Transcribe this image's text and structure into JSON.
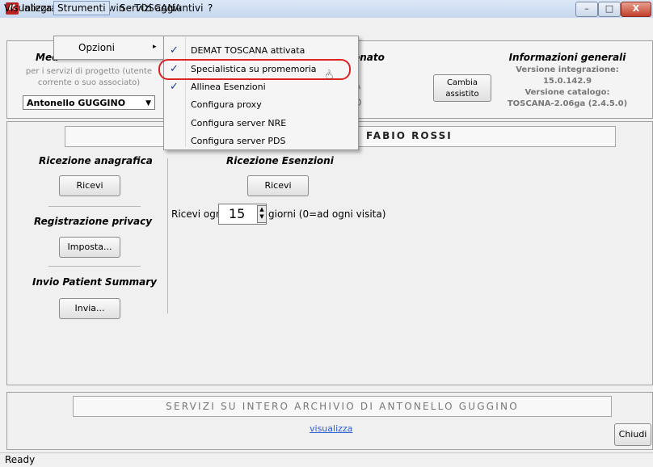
{
  "window": {
    "title": "Integrazione Millewin - TOSCANA",
    "min_glyph": "–",
    "max_glyph": "□",
    "close_glyph": "X"
  },
  "menubar": {
    "visualizza": "Visualizza",
    "strumenti": "Strumenti",
    "servizi": "Servizi aggiuntivi",
    "help": "?"
  },
  "strumenti_menu": {
    "opzioni": "Opzioni",
    "opzioni_arrow": "▸"
  },
  "opzioni_submenu": {
    "items": [
      {
        "label": "DEMAT TOSCANA attivata",
        "checked": true
      },
      {
        "label": "Specialistica su promemoria",
        "checked": true
      },
      {
        "label": "Allinea Esenzioni",
        "checked": true
      },
      {
        "label": "Configura proxy",
        "checked": false
      },
      {
        "label": "Configura server NRE",
        "checked": false
      },
      {
        "label": "Configura server PDS",
        "checked": false
      }
    ],
    "check_glyph": "✓"
  },
  "top_panel": {
    "medico_title": "Med",
    "medico_desc": "per i servizi di progetto (utente corrente o suo associato)",
    "selected_user": "Antonello GUGGINO",
    "assistito_title": "onato",
    "ghost_a": "A",
    "ghost_o": "O",
    "cambia_button": "Cambia assistito",
    "info_title": "Informazioni generali",
    "info_lines": [
      "Versione integrazione:",
      "15.0.142.9",
      "Versione catalogo:",
      "TOSCANA-2.06ga (2.4.5.0)"
    ]
  },
  "patient": {
    "label": ":   FABIO ROSSI"
  },
  "left_sections": {
    "ricezione_anagrafica": "Ricezione anagrafica",
    "ricevi": "Ricevi",
    "registrazione_privacy": "Registrazione privacy",
    "imposta": "Imposta...",
    "invio_patient_summary": "Invio Patient Summary",
    "invia": "Invia..."
  },
  "esenzioni": {
    "title": "Ricezione Esenzioni",
    "ricevi": "Ricevi",
    "ricevi_ogni": "Ricevi ogni",
    "days_value": "15",
    "giorni_label": "giorni (0=ad ogni visita)"
  },
  "archive": {
    "banner": "SERVIZI SU INTERO ARCHIVIO DI ANTONELLO GUGGINO",
    "link": "visualizza",
    "chiudi": "Chiudi"
  },
  "status": {
    "text": "Ready"
  }
}
